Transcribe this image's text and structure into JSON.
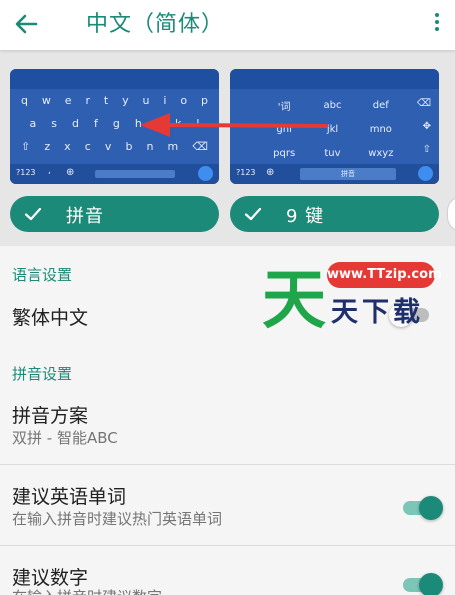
{
  "header": {
    "title": "中文（简体）"
  },
  "keyboards": {
    "qwerty": {
      "rows": [
        [
          "q",
          "w",
          "e",
          "r",
          "t",
          "y",
          "u",
          "i",
          "o",
          "p"
        ],
        [
          "a",
          "s",
          "d",
          "f",
          "g",
          "h",
          "j",
          "k",
          "l"
        ],
        [
          "⇧",
          "z",
          "x",
          "c",
          "v",
          "b",
          "n",
          "m",
          "⌫"
        ]
      ],
      "bottom": [
        "?123",
        ","
      ]
    },
    "ninekey": {
      "cells": [
        "'词",
        "abc",
        "def",
        "ghi",
        "jkl",
        "mno",
        "pqrs",
        "tuv",
        "wxyz"
      ],
      "bottom_left": "?123",
      "space_label": "拼音"
    }
  },
  "layouts": [
    {
      "label": "拼音",
      "selected": true
    },
    {
      "label": "9 键",
      "selected": true
    }
  ],
  "settings": {
    "language_section": "语言设置",
    "traditional": {
      "title": "繁体中文",
      "enabled": false
    },
    "pinyin_section": "拼音设置",
    "scheme": {
      "title": "拼音方案",
      "value": "双拼 - 智能ABC"
    },
    "english": {
      "title": "建议英语单词",
      "subtitle": "在输入拼音时建议热门英语单词",
      "enabled": true
    },
    "numbers": {
      "title": "建议数字",
      "subtitle": "在输入拼音时建议数字",
      "enabled": true
    }
  },
  "watermark": {
    "url": "www.TTzip.com",
    "big": "天",
    "text": "天下载"
  },
  "colors": {
    "accent": "#1b8a78",
    "keyboard": "#2f5fb0",
    "arrow": "#e53935"
  }
}
